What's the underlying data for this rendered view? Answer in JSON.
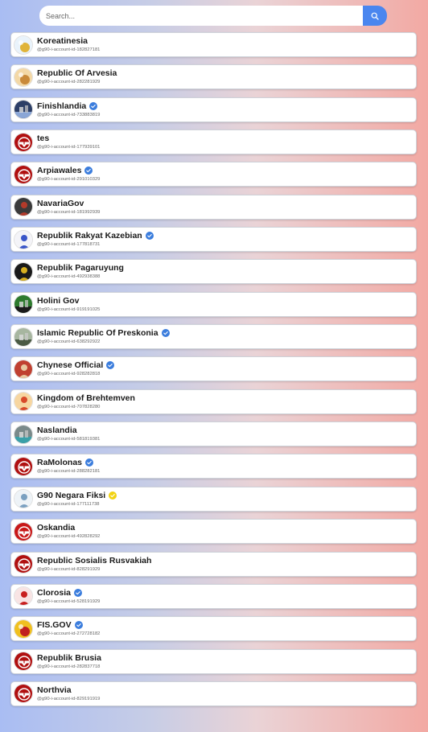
{
  "search": {
    "placeholder": "Search..."
  },
  "colors": {
    "verified_blue": "#3b7ddd",
    "verified_gold": "#f2d312",
    "search_button": "#4a86ef"
  },
  "accounts": [
    {
      "name": "Koreatinesia",
      "handle": "@g90-i-account-id-182827181",
      "badge": "none",
      "avatar": {
        "bg": "#e9f3fb",
        "fg": "#e0b43a",
        "style": "sun"
      }
    },
    {
      "name": "Republic Of Arvesia",
      "handle": "@g90-i-account-id-282281929",
      "badge": "none",
      "avatar": {
        "bg": "#f3d8a6",
        "fg": "#c98a3a",
        "style": "sun"
      }
    },
    {
      "name": "Finishlandia",
      "handle": "@g90-i-account-id-733883819",
      "badge": "blue",
      "avatar": {
        "bg": "#2c3e66",
        "fg": "#8aa6d6",
        "style": "scene"
      }
    },
    {
      "name": "tes",
      "handle": "@g90-i-account-id-177939101",
      "badge": "none",
      "avatar": {
        "bg": "#b01010",
        "fg": "#ffffff",
        "style": "emblem"
      }
    },
    {
      "name": "Arpiawales",
      "handle": "@g90-i-account-id-291010329",
      "badge": "blue",
      "avatar": {
        "bg": "#b01010",
        "fg": "#ffffff",
        "style": "emblem"
      }
    },
    {
      "name": "NavariaGov",
      "handle": "@g90-i-account-id-181992939",
      "badge": "none",
      "avatar": {
        "bg": "#3a3a3a",
        "fg": "#b33a2a",
        "style": "figure"
      }
    },
    {
      "name": "Republik Rakyat Kazebian",
      "handle": "@g90-i-account-id-177818731",
      "badge": "blue",
      "avatar": {
        "bg": "#f4f4f8",
        "fg": "#3a56c8",
        "style": "figure"
      }
    },
    {
      "name": "Republik Pagaruyung",
      "handle": "@g90-i-account-id-492938388",
      "badge": "none",
      "avatar": {
        "bg": "#1a1a1a",
        "fg": "#d8b020",
        "style": "figure"
      }
    },
    {
      "name": "Holini Gov",
      "handle": "@g90-i-account-id-919191025",
      "badge": "none",
      "avatar": {
        "bg": "#2d7a2d",
        "fg": "#1a1a1a",
        "style": "scene"
      }
    },
    {
      "name": "Islamic Republic Of Preskonia",
      "handle": "@g90-i-account-id-638292922",
      "badge": "blue",
      "avatar": {
        "bg": "#a7b6a0",
        "fg": "#4a5a44",
        "style": "scene"
      }
    },
    {
      "name": "Chynese Official",
      "handle": "@g90-i-account-id-928282818",
      "badge": "blue",
      "avatar": {
        "bg": "#c04030",
        "fg": "#e8c8a0",
        "style": "figure"
      }
    },
    {
      "name": "Kingdom of Brehtemven",
      "handle": "@g90-i-account-id-707828280",
      "badge": "none",
      "avatar": {
        "bg": "#f7d6a0",
        "fg": "#d84a2a",
        "style": "figure"
      }
    },
    {
      "name": "Naslandia",
      "handle": "@g90-i-account-id-581819381",
      "badge": "none",
      "avatar": {
        "bg": "#7a8a8a",
        "fg": "#3aa0a8",
        "style": "scene"
      }
    },
    {
      "name": "RaMolonas",
      "handle": "@g90-i-account-id-288282181",
      "badge": "blue",
      "avatar": {
        "bg": "#b01010",
        "fg": "#ffffff",
        "style": "emblem"
      }
    },
    {
      "name": "G90 Negara Fiksi",
      "handle": "@g90-i-account-id-177111738",
      "badge": "gold",
      "avatar": {
        "bg": "#eef3f7",
        "fg": "#7aa0c0",
        "style": "figure"
      }
    },
    {
      "name": "Oskandia",
      "handle": "@g90-i-account-id-492828292",
      "badge": "none",
      "avatar": {
        "bg": "#c81818",
        "fg": "#ffffff",
        "style": "emblem"
      }
    },
    {
      "name": "Republic Sosialis Rusvakiah",
      "handle": "@g90-i-account-id-828291929",
      "badge": "none",
      "avatar": {
        "bg": "#b01010",
        "fg": "#ffffff",
        "style": "emblem"
      }
    },
    {
      "name": "Clorosia",
      "handle": "@g90-i-account-id-528191929",
      "badge": "blue",
      "avatar": {
        "bg": "#f8e4e4",
        "fg": "#c82020",
        "style": "figure"
      }
    },
    {
      "name": "FIS.GOV",
      "handle": "@g90-i-account-id-272728182",
      "badge": "blue",
      "avatar": {
        "bg": "#f0c020",
        "fg": "#c02020",
        "style": "sun"
      }
    },
    {
      "name": "Republik Brusia",
      "handle": "@g90-i-account-id-282837718",
      "badge": "none",
      "avatar": {
        "bg": "#b01010",
        "fg": "#ffffff",
        "style": "emblem"
      }
    },
    {
      "name": "Northvia",
      "handle": "@g90-i-account-id-829191919",
      "badge": "none",
      "avatar": {
        "bg": "#b01010",
        "fg": "#ffffff",
        "style": "emblem"
      }
    }
  ]
}
